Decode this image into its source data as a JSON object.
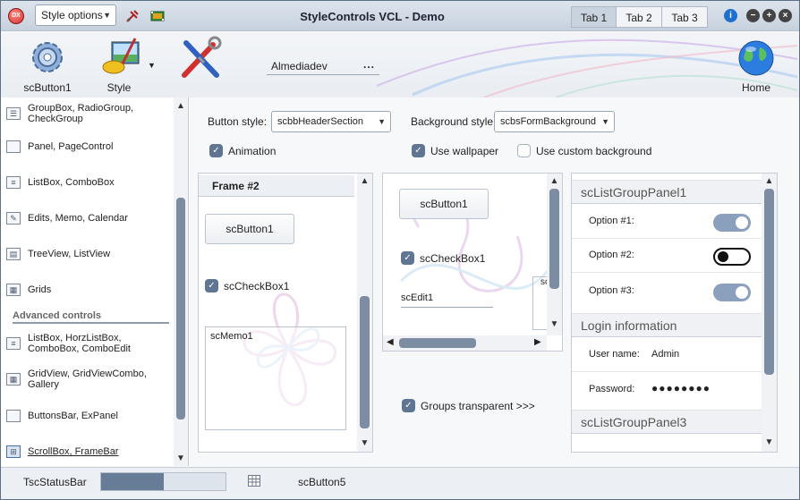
{
  "window": {
    "title": "StyleControls VCL - Demo",
    "app_icon_text": "DX",
    "style_combo": "Style options",
    "tabs": [
      "Tab 1",
      "Tab 2",
      "Tab 3"
    ],
    "active_tab": 0,
    "icons": [
      "pin-tool-icon",
      "film-icon",
      "info-icon",
      "minimize-icon",
      "maximize-icon",
      "close-icon"
    ]
  },
  "toolbar": {
    "button1_label": "scButton1",
    "style_label": "Style",
    "edit_value": "Almediadev",
    "edit_dots": "...",
    "home_label": "Home"
  },
  "left_panel": {
    "items": [
      "GroupBox, RadioGroup,\nCheckGroup",
      "Panel, PageControl",
      "ListBox, ComboBox",
      "Edits, Memo, Calendar",
      "TreeView, ListView",
      "Grids"
    ],
    "section_header": "Advanced controls",
    "advanced_items": [
      "ListBox, HorzListBox,\nComboBox, ComboEdit",
      "GridView, GridViewCombo,\nGallery",
      "ButtonsBar, ExPanel",
      "ScrollBox, FrameBar"
    ],
    "selected_advanced": 3
  },
  "options": {
    "button_style_label": "Button style:",
    "button_style_value": "scbbHeaderSection",
    "background_style_label": "Background style:",
    "background_style_value": "scbsFormBackground",
    "animation_label": "Animation",
    "animation_checked": true,
    "use_wallpaper_label": "Use wallpaper",
    "use_wallpaper_checked": true,
    "custom_bg_label": "Use custom background",
    "custom_bg_checked": false
  },
  "frame_panel": {
    "header": "Frame #2",
    "button_label": "scButton1",
    "checkbox_label": "scCheckBox1",
    "checkbox_checked": true,
    "memo_label": "scMemo1"
  },
  "scroll_panel": {
    "button_label": "scButton1",
    "checkbox_label": "scCheckBox1",
    "checkbox_checked": true,
    "edit_label": "scEdit1",
    "cut_text": "sc"
  },
  "groups_transparent_label": "Groups transparent >>>",
  "groups_transparent_checked": true,
  "list_group": {
    "panel1_title": "scListGroupPanel1",
    "options": [
      {
        "label": "Option #1:",
        "on": true
      },
      {
        "label": "Option #2:",
        "on": false
      },
      {
        "label": "Option #3:",
        "on": true
      }
    ],
    "login_title": "Login information",
    "user_label": "User name:",
    "user_value": "Admin",
    "password_label": "Password:",
    "password_value": "●●●●●●●●",
    "panel3_title": "scListGroupPanel3"
  },
  "status_bar": {
    "text": "TscStatusBar",
    "progress_fraction": 0.5,
    "button_label": "scButton5"
  },
  "colors": {
    "accent": "#5f7591",
    "scroll_thumb": "#7c8ca3",
    "toggle_on": "#8aa0bc"
  }
}
